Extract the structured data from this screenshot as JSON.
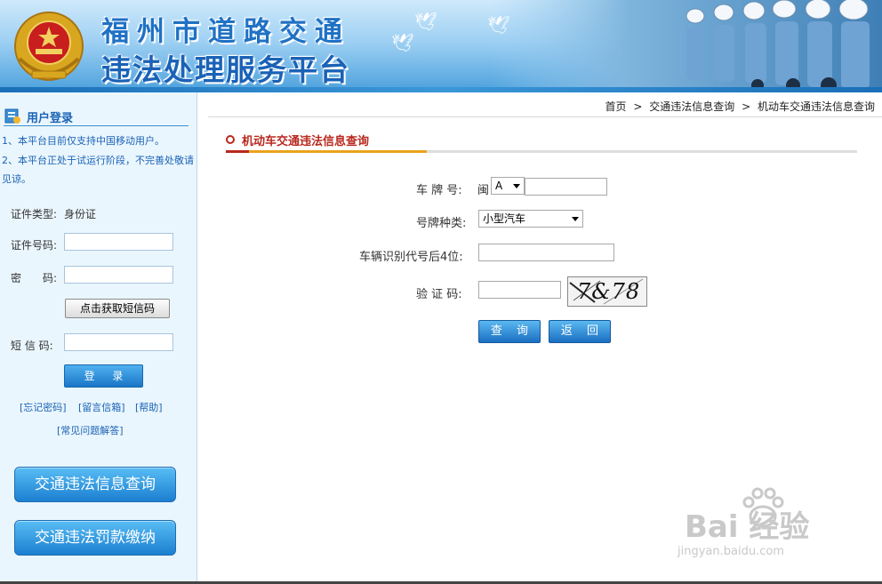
{
  "banner": {
    "title_line1": "福州市道路交通",
    "title_line2": "违法处理服务平台"
  },
  "sidebar": {
    "header": "用户登录",
    "notice1": "1、本平台目前仅支持中国移动用户。",
    "notice2": "2、本平台正处于试运行阶段，不完善处敬请见谅。",
    "id_type_label": "证件类型:",
    "id_type_value": "身份证",
    "id_no_label": "证件号码:",
    "password_label": "密　　码:",
    "sms_button": "点击获取短信码",
    "sms_label": "短 信 码:",
    "login_button": "登 录",
    "link_forgot": "[忘记密码]",
    "link_mailbox": "[留言信箱]",
    "link_help": "[帮助]",
    "link_faq": "[常见问题解答]",
    "btn_query": "交通违法信息查询",
    "btn_pay": "交通违法罚款缴纳"
  },
  "breadcrumb": {
    "home": "首页",
    "sep": ">",
    "level1": "交通违法信息查询",
    "level2": "机动车交通违法信息查询"
  },
  "section": {
    "title": "机动车交通违法信息查询"
  },
  "form": {
    "plate_label": "车 牌 号:",
    "plate_prefix": "闽",
    "plate_letter": "A",
    "plate_type_label": "号牌种类:",
    "plate_type_value": "小型汽车",
    "vin_label": "车辆识别代号后4位:",
    "captcha_label": "验 证 码:",
    "captcha_text": "7&78",
    "query_button": "查 询",
    "back_button": "返 回"
  },
  "watermark": {
    "main": "Bai 经验",
    "sub": "jingyan.baidu.com"
  },
  "colors": {
    "primary_blue": "#1a62b6",
    "accent_red": "#b8281e",
    "accent_orange": "#e9a21a"
  }
}
